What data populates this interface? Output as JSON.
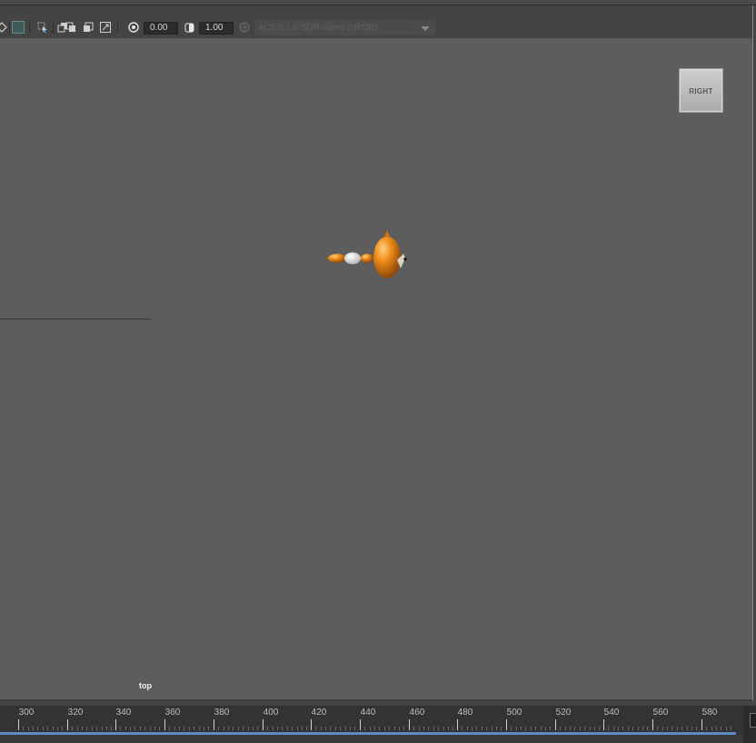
{
  "toolbar": {
    "exposure_value": "0.00",
    "gamma_value": "1.00",
    "color_space": "ACES 1.0 SDR-video (sRGB)",
    "icons": [
      "camera-attributes-icon",
      "grid-toggle-icon",
      "select-camera-icon",
      "isolate-select-icon",
      "xray-icon",
      "frame-all-icon",
      "exposure-icon",
      "gamma-icon",
      "color-management-icon"
    ]
  },
  "viewport": {
    "view_cube_label": "RIGHT",
    "camera_name": "top",
    "background_color": "#5d5d5d",
    "model_color": "#e07a10"
  },
  "timeline": {
    "ticks": [
      "300",
      "320",
      "340",
      "360",
      "380",
      "400",
      "420",
      "440",
      "460",
      "480",
      "500",
      "520",
      "540",
      "560",
      "580"
    ],
    "range_bar_color": "#5b8ac4"
  }
}
